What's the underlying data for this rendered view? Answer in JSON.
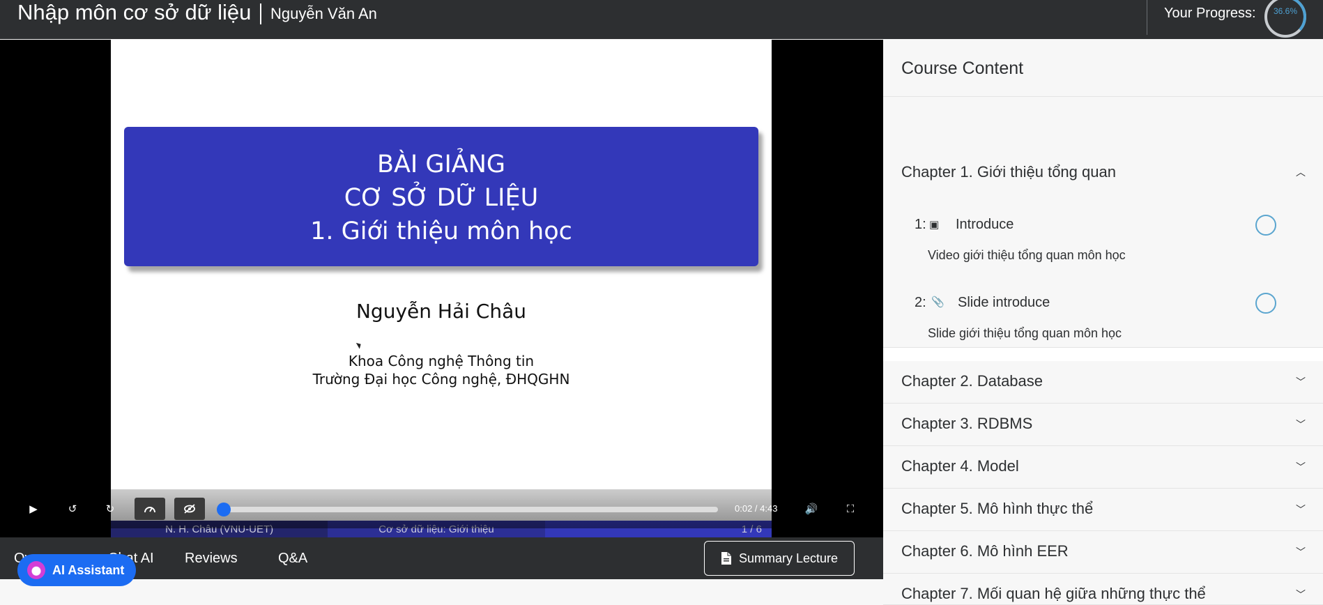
{
  "header": {
    "course_title": "Nhập môn cơ sở dữ liệu",
    "author": "Nguyễn Văn An",
    "progress_label": "Your Progress:",
    "progress_value": "36.6%",
    "progress_fraction": 0.366,
    "accent": "#4ea1d3"
  },
  "slide": {
    "title_lines": [
      "BÀI GIẢNG",
      "CƠ SỞ DỮ LIỆU",
      "1. Giới thiệu môn học"
    ],
    "author": "Nguyễn Hải Châu",
    "institution_lines": [
      "Khoa Công nghệ Thông tin",
      "Trường Đại học Công nghệ, ĐHQGHN"
    ],
    "footer": [
      "N. H. Châu (VNU-UET)",
      "Cơ sở dữ liệu: Giới thiệu",
      "1 / 6"
    ]
  },
  "player": {
    "time": "0:02 / 4:43",
    "played_fraction": 0.007,
    "icons": [
      "play-icon",
      "rewind-icon",
      "forward-icon",
      "speed-icon",
      "hide-icon",
      "volume-icon",
      "fullscreen-icon"
    ]
  },
  "tabs": [
    {
      "label": "Ov"
    },
    {
      "label": "Chat AI"
    },
    {
      "label": "Reviews"
    },
    {
      "label": "Q&A"
    }
  ],
  "summary_button": "Summary Lecture",
  "ai_button": "AI Assistant",
  "sidebar": {
    "title": "Course Content",
    "open_chapter": {
      "title": "Chapter 1. Giới thiệu tổng quan",
      "lessons": [
        {
          "num": "1:",
          "icon": "video-icon",
          "name": "Introduce",
          "desc": "Video giới thiệu tổng quan môn học"
        },
        {
          "num": "2:",
          "icon": "attachment-icon",
          "name": "Slide introduce",
          "desc": "Slide giới thiệu tổng quan môn học"
        }
      ]
    },
    "chapters": [
      "Chapter 2. Database",
      "Chapter 3. RDBMS",
      "Chapter 4. Model",
      "Chapter 5. Mô hình thực thể",
      "Chapter 6. Mô hình EER",
      "Chapter 7. Mối quan hệ giữa những thực thể"
    ]
  }
}
